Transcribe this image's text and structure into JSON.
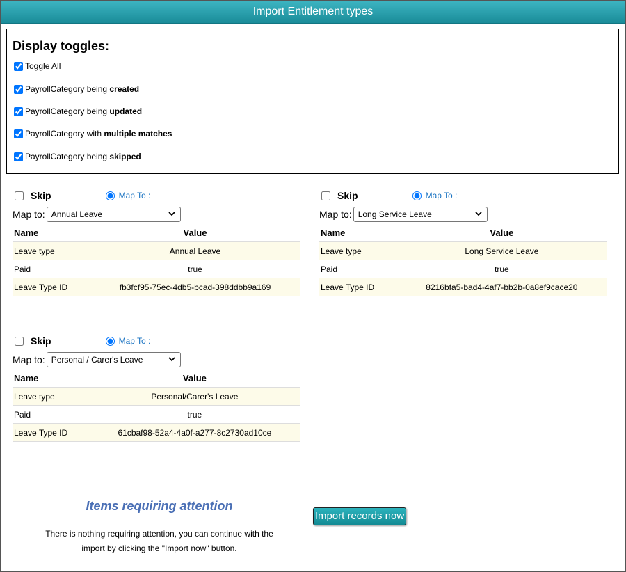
{
  "window": {
    "title": "Import Entitlement types"
  },
  "toggles": {
    "heading": "Display toggles:",
    "items": [
      {
        "label_pre": "Toggle All",
        "label_bold": "",
        "checked": true
      },
      {
        "label_pre": "PayrollCategory being ",
        "label_bold": "created",
        "checked": true
      },
      {
        "label_pre": "PayrollCategory being ",
        "label_bold": "updated",
        "checked": true
      },
      {
        "label_pre": "PayrollCategory with ",
        "label_bold": "multiple matches",
        "checked": true
      },
      {
        "label_pre": "PayrollCategory being ",
        "label_bold": "skipped",
        "checked": true
      }
    ]
  },
  "mappings": [
    {
      "skip_label": "Skip",
      "map_radio_label": "Map To :",
      "map_to_label": "Map to:",
      "selected": "Annual Leave",
      "col_name": "Name",
      "col_value": "Value",
      "rows": [
        {
          "name": "Leave type",
          "value": "Annual Leave"
        },
        {
          "name": "Paid",
          "value": "true"
        },
        {
          "name": "Leave Type ID",
          "value": "fb3fcf95-75ec-4db5-bcad-398ddbb9a169"
        }
      ]
    },
    {
      "skip_label": "Skip",
      "map_radio_label": "Map To :",
      "map_to_label": "Map to:",
      "selected": "Long Service Leave",
      "col_name": "Name",
      "col_value": "Value",
      "rows": [
        {
          "name": "Leave type",
          "value": "Long Service Leave"
        },
        {
          "name": "Paid",
          "value": "true"
        },
        {
          "name": "Leave Type ID",
          "value": "8216bfa5-bad4-4af7-bb2b-0a8ef9cace20"
        }
      ]
    },
    {
      "skip_label": "Skip",
      "map_radio_label": "Map To :",
      "map_to_label": "Map to:",
      "selected": "Personal / Carer's Leave",
      "col_name": "Name",
      "col_value": "Value",
      "rows": [
        {
          "name": "Leave type",
          "value": "Personal/Carer's Leave"
        },
        {
          "name": "Paid",
          "value": "true"
        },
        {
          "name": "Leave Type ID",
          "value": "61cbaf98-52a4-4a0f-a277-8c2730ad10ce"
        }
      ]
    }
  ],
  "attention": {
    "title": "Items requiring attention",
    "message": "There is nothing requiring attention, you can continue with the import by clicking the \"Import now\" button."
  },
  "import_button": {
    "label": "Import records now"
  }
}
